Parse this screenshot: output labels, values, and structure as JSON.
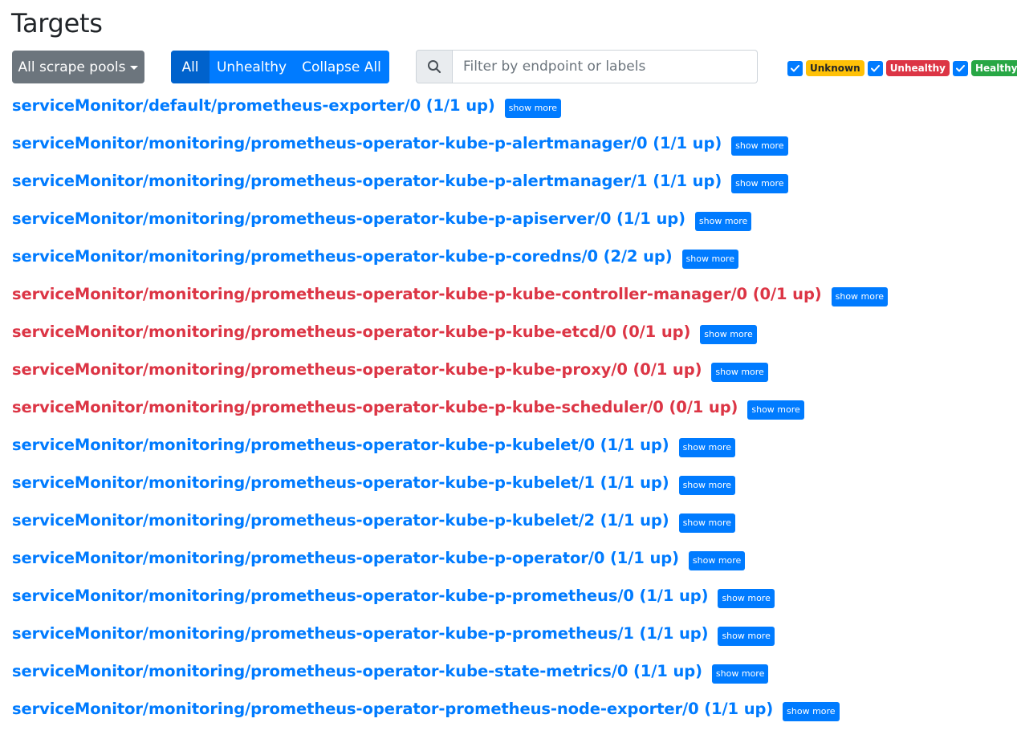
{
  "page": {
    "title": "Targets"
  },
  "toolbar": {
    "scrape_pools_label": "All scrape pools",
    "filter_all_label": "All",
    "filter_unhealthy_label": "Unhealthy",
    "collapse_all_label": "Collapse All",
    "search_placeholder": "Filter by endpoint or labels",
    "search_value": ""
  },
  "health_filters": [
    {
      "label": "Unknown",
      "checked": true,
      "color": "#ffc107"
    },
    {
      "label": "Unhealthy",
      "checked": true,
      "color": "#dc3545"
    },
    {
      "label": "Healthy",
      "checked": true,
      "color": "#28a745"
    }
  ],
  "show_more_label": "show more",
  "colors": {
    "accent": "#007bff",
    "unhealthy": "#dc3545",
    "secondary": "#6c757d"
  },
  "pools": [
    {
      "title": "serviceMonitor/default/prometheus-exporter/0 (1/1 up)",
      "healthy": true
    },
    {
      "title": "serviceMonitor/monitoring/prometheus-operator-kube-p-alertmanager/0 (1/1 up)",
      "healthy": true
    },
    {
      "title": "serviceMonitor/monitoring/prometheus-operator-kube-p-alertmanager/1 (1/1 up)",
      "healthy": true
    },
    {
      "title": "serviceMonitor/monitoring/prometheus-operator-kube-p-apiserver/0 (1/1 up)",
      "healthy": true
    },
    {
      "title": "serviceMonitor/monitoring/prometheus-operator-kube-p-coredns/0 (2/2 up)",
      "healthy": true
    },
    {
      "title": "serviceMonitor/monitoring/prometheus-operator-kube-p-kube-controller-manager/0 (0/1 up)",
      "healthy": false
    },
    {
      "title": "serviceMonitor/monitoring/prometheus-operator-kube-p-kube-etcd/0 (0/1 up)",
      "healthy": false
    },
    {
      "title": "serviceMonitor/monitoring/prometheus-operator-kube-p-kube-proxy/0 (0/1 up)",
      "healthy": false
    },
    {
      "title": "serviceMonitor/monitoring/prometheus-operator-kube-p-kube-scheduler/0 (0/1 up)",
      "healthy": false
    },
    {
      "title": "serviceMonitor/monitoring/prometheus-operator-kube-p-kubelet/0 (1/1 up)",
      "healthy": true
    },
    {
      "title": "serviceMonitor/monitoring/prometheus-operator-kube-p-kubelet/1 (1/1 up)",
      "healthy": true
    },
    {
      "title": "serviceMonitor/monitoring/prometheus-operator-kube-p-kubelet/2 (1/1 up)",
      "healthy": true
    },
    {
      "title": "serviceMonitor/monitoring/prometheus-operator-kube-p-operator/0 (1/1 up)",
      "healthy": true
    },
    {
      "title": "serviceMonitor/monitoring/prometheus-operator-kube-p-prometheus/0 (1/1 up)",
      "healthy": true
    },
    {
      "title": "serviceMonitor/monitoring/prometheus-operator-kube-p-prometheus/1 (1/1 up)",
      "healthy": true
    },
    {
      "title": "serviceMonitor/monitoring/prometheus-operator-kube-state-metrics/0 (1/1 up)",
      "healthy": true
    },
    {
      "title": "serviceMonitor/monitoring/prometheus-operator-prometheus-node-exporter/0 (1/1 up)",
      "healthy": true
    }
  ]
}
